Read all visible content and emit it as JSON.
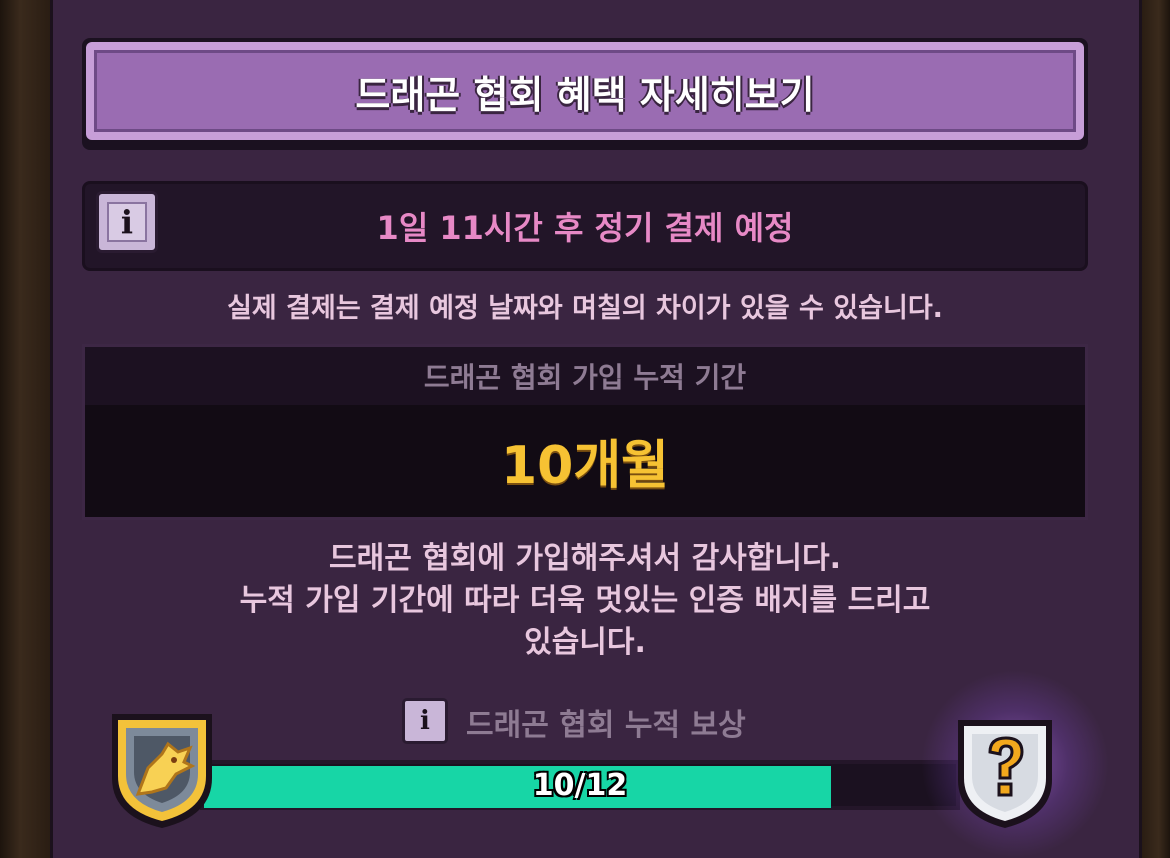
{
  "header": {
    "title": "드래곤 협회 혜택 자세히보기"
  },
  "billing": {
    "info_icon": "info-icon",
    "next_payment": "1일 11시간 후 정기 결제 예정",
    "note": "실제 결제는 결제 예정 날짜와 며칠의 차이가 있을 수 있습니다."
  },
  "membership": {
    "label": "드래곤 협회 가입 누적 기간",
    "value": "10개월"
  },
  "thanks": {
    "line1": "드래곤 협회에 가입해주셔서 감사합니다.",
    "line2": "누적 가입 기간에 따라 더욱 멋있는 인증 배지를 드리고",
    "line3": "있습니다."
  },
  "reward": {
    "info_icon": "info-icon",
    "label": "드래곤 협회 누적 보상",
    "current_badge_icon": "dragon-badge-icon",
    "next_badge_icon": "mystery-badge-icon",
    "progress_text": "10/12",
    "progress_current": 10,
    "progress_max": 12,
    "bar_color": "#17d6a6"
  },
  "colors": {
    "panel": "#3a2541",
    "accent_pink": "#e789c6",
    "highlight_gold": "#f6c233"
  }
}
